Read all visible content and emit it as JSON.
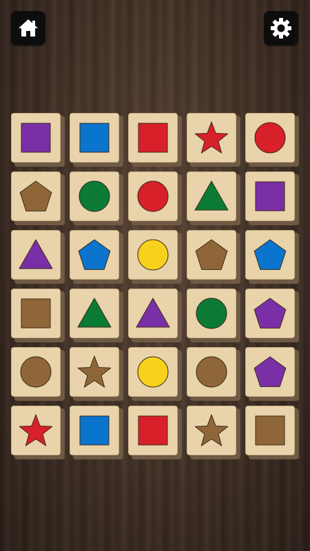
{
  "header": {
    "home_icon": "home-icon",
    "settings_icon": "gear-icon"
  },
  "colors": {
    "purple": "#7b2fa6",
    "blue": "#0b74cc",
    "red": "#d7202a",
    "green": "#0a7a34",
    "brown": "#8f6638",
    "yellow": "#f7d11b",
    "tile_face": "#e9d3ab",
    "tile_side": "#6f5a44"
  },
  "board": {
    "rows": 6,
    "cols": 5,
    "tiles": [
      {
        "shape": "square",
        "color": "purple"
      },
      {
        "shape": "square",
        "color": "blue"
      },
      {
        "shape": "square",
        "color": "red"
      },
      {
        "shape": "star",
        "color": "red"
      },
      {
        "shape": "circle",
        "color": "red"
      },
      {
        "shape": "pentagon",
        "color": "brown"
      },
      {
        "shape": "circle",
        "color": "green"
      },
      {
        "shape": "circle",
        "color": "red"
      },
      {
        "shape": "triangle",
        "color": "green"
      },
      {
        "shape": "square",
        "color": "purple"
      },
      {
        "shape": "triangle",
        "color": "purple"
      },
      {
        "shape": "pentagon",
        "color": "blue"
      },
      {
        "shape": "circle",
        "color": "yellow"
      },
      {
        "shape": "pentagon",
        "color": "brown"
      },
      {
        "shape": "pentagon",
        "color": "blue"
      },
      {
        "shape": "square",
        "color": "brown"
      },
      {
        "shape": "triangle",
        "color": "green"
      },
      {
        "shape": "triangle",
        "color": "purple"
      },
      {
        "shape": "circle",
        "color": "green"
      },
      {
        "shape": "pentagon",
        "color": "purple"
      },
      {
        "shape": "circle",
        "color": "brown"
      },
      {
        "shape": "star",
        "color": "brown"
      },
      {
        "shape": "circle",
        "color": "yellow"
      },
      {
        "shape": "circle",
        "color": "brown"
      },
      {
        "shape": "pentagon",
        "color": "purple"
      },
      {
        "shape": "star",
        "color": "red"
      },
      {
        "shape": "square",
        "color": "blue"
      },
      {
        "shape": "square",
        "color": "red"
      },
      {
        "shape": "star",
        "color": "brown"
      },
      {
        "shape": "square",
        "color": "brown"
      }
    ]
  }
}
